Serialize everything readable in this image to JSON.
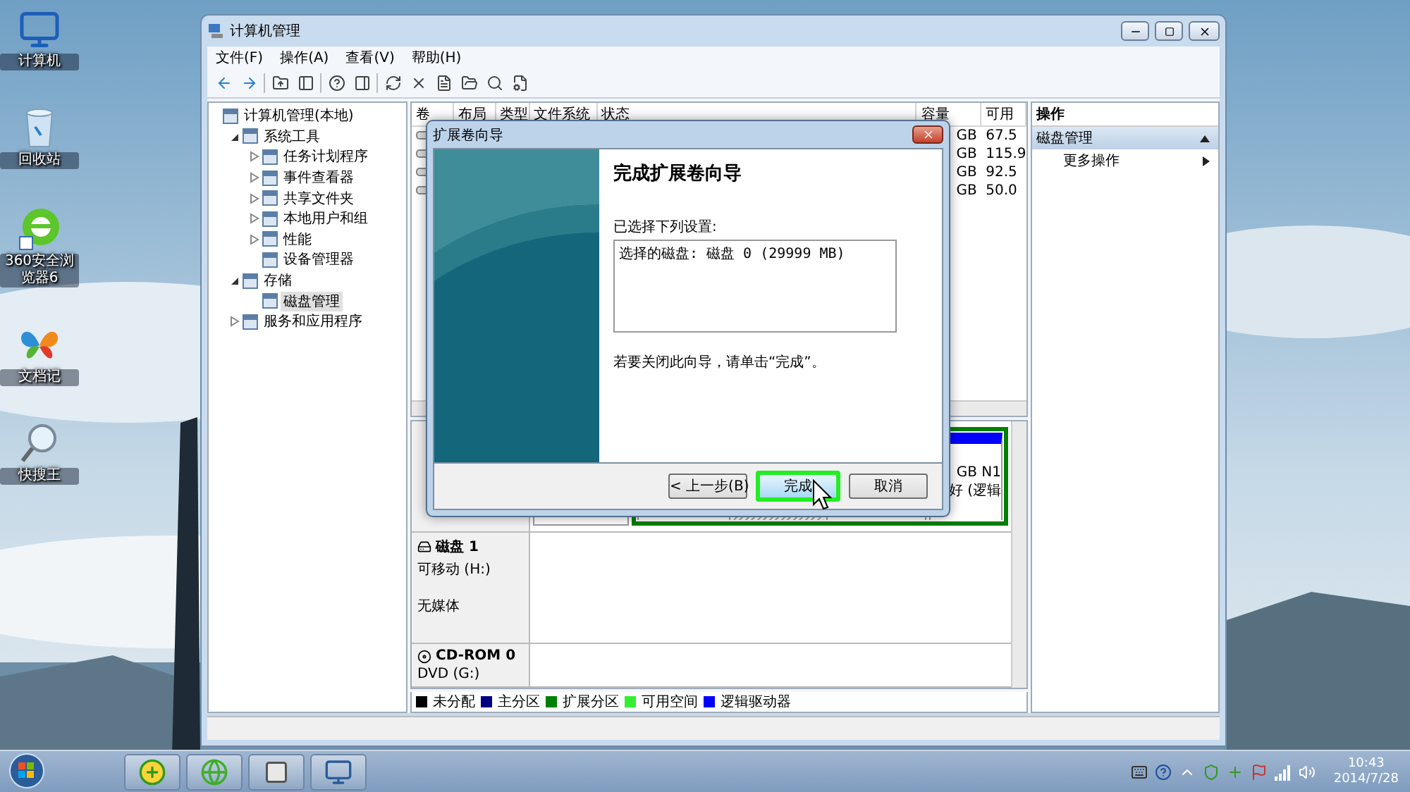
{
  "desktop": {
    "icons": [
      {
        "kind": "computer",
        "label": "计算机"
      },
      {
        "kind": "trash",
        "label": "回收站"
      },
      {
        "kind": "browser",
        "label": "360安全浏览器6"
      },
      {
        "kind": "butterfly",
        "label": "文档记"
      },
      {
        "kind": "search",
        "label": "快搜王"
      }
    ]
  },
  "window": {
    "title": "计算机管理",
    "menu": [
      "文件(F)",
      "操作(A)",
      "查看(V)",
      "帮助(H)"
    ],
    "tree": [
      {
        "label": "计算机管理(本地)",
        "selected": false,
        "children": [
          {
            "label": "系统工具",
            "expanded": true,
            "selected": false,
            "children": [
              {
                "label": "任务计划程序",
                "expanded": false,
                "selected": false
              },
              {
                "label": "事件查看器",
                "expanded": false,
                "selected": false
              },
              {
                "label": "共享文件夹",
                "expanded": false,
                "selected": false
              },
              {
                "label": "本地用户和组",
                "expanded": false,
                "selected": false
              },
              {
                "label": "性能",
                "expanded": false,
                "selected": false
              },
              {
                "label": "设备管理器",
                "selected": false
              }
            ]
          },
          {
            "label": "存储",
            "expanded": true,
            "selected": false,
            "children": [
              {
                "label": "磁盘管理",
                "selected": true
              }
            ]
          },
          {
            "label": "服务和应用程序",
            "expanded": false,
            "selected": false
          }
        ]
      }
    ],
    "volumes": {
      "columns": [
        "卷",
        "布局",
        "类型",
        "文件系统",
        "状态",
        "容量",
        "可用"
      ],
      "rows": [
        {
          "capacity": "GB",
          "free": "67.5"
        },
        {
          "capacity": "GB",
          "free": "115.9"
        },
        {
          "capacity": "GB",
          "free": "92.5"
        },
        {
          "capacity": "GB",
          "free": "50.0"
        }
      ]
    },
    "disk0_texts": [
      "GB N1",
      "好 (逻辑"
    ],
    "disks": [
      {
        "kind": "removable",
        "name": "磁盘 1",
        "type": "可移动 (H:)",
        "status": "无媒体"
      },
      {
        "kind": "cdrom",
        "name": "CD-ROM 0",
        "type": "DVD (G:)"
      }
    ],
    "legend": [
      {
        "label": "未分配",
        "color": "#000000"
      },
      {
        "label": "主分区",
        "color": "#000080"
      },
      {
        "label": "扩展分区",
        "color": "#008000"
      },
      {
        "label": "可用空间",
        "color": "#33ee33"
      },
      {
        "label": "逻辑驱动器",
        "color": "#0000ff"
      }
    ],
    "actions": {
      "header": "操作",
      "section": "磁盘管理",
      "items": [
        "更多操作"
      ]
    }
  },
  "dialog": {
    "title": "扩展卷向导",
    "heading": "完成扩展卷向导",
    "settings_label": "已选择下列设置:",
    "settings_text": "选择的磁盘: 磁盘 0 (29999 MB)",
    "hint": "若要关闭此向导，请单击“完成”。",
    "buttons": [
      {
        "label": "< 上一步(B)",
        "highlighted": false
      },
      {
        "label": "完成",
        "highlighted": true
      },
      {
        "label": "取消",
        "highlighted": false
      }
    ]
  },
  "clock": {
    "time": "10:43",
    "date": "2014/7/28"
  }
}
